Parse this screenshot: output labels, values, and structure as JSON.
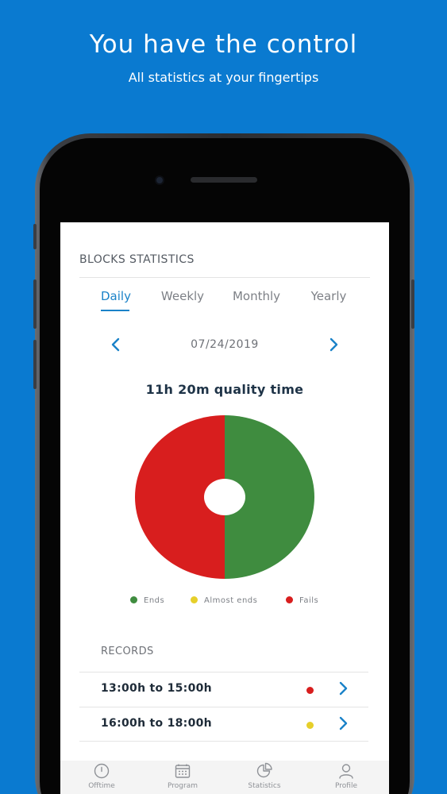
{
  "hero": {
    "title": "You have the control",
    "subtitle": "All statistics at your fingertips"
  },
  "screen": {
    "section_title": "BLOCKS STATISTICS",
    "tabs": [
      {
        "label": "Daily",
        "active": true
      },
      {
        "label": "Weekly",
        "active": false
      },
      {
        "label": "Monthly",
        "active": false
      },
      {
        "label": "Yearly",
        "active": false
      }
    ],
    "date": "07/24/2019",
    "quality_time": "11h 20m quality time",
    "records_title": "RECORDS",
    "records": [
      {
        "time": "13:00h to 15:00h",
        "status_color": "#d81e1e"
      },
      {
        "time": "16:00h to 18:00h",
        "status_color": "#e6cf2a"
      }
    ]
  },
  "chart_data": {
    "type": "pie",
    "title": "",
    "categories": [
      "Ends",
      "Almost ends",
      "Fails"
    ],
    "values": [
      50,
      0,
      50
    ],
    "colors": [
      "#3f8c3f",
      "#e6cf2a",
      "#d81e1e"
    ],
    "legend": "bottom"
  },
  "tabbar": {
    "items": [
      {
        "label": "Offtime",
        "icon": "clock-icon"
      },
      {
        "label": "Program",
        "icon": "calendar-icon"
      },
      {
        "label": "Statistics",
        "icon": "pie-chart-icon"
      },
      {
        "label": "Profile",
        "icon": "user-icon"
      }
    ]
  },
  "colors": {
    "background": "#0a7ad0",
    "accent": "#1a82c8"
  }
}
